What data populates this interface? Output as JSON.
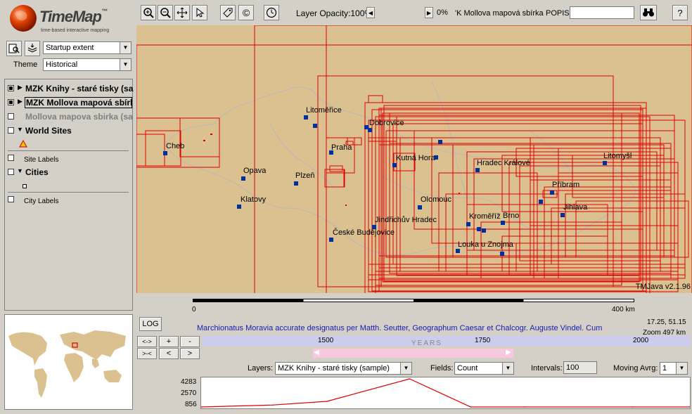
{
  "logo": {
    "title": "TimeMap",
    "tm": "™",
    "subtitle": "time-based interactive mapping"
  },
  "toolbar": {
    "layer_opacity_label": "Layer Opacity:",
    "layer_opacity_value": "100%",
    "opacity_right_value": "0%",
    "active_layer_text": "'K Mollova mapová sbírka",
    "popis_label": "POPIS",
    "popis_value": "",
    "help_label": "?",
    "copyright_label": "©"
  },
  "extent": {
    "selected": "Startup extent"
  },
  "theme": {
    "label": "Theme",
    "selected": "Historical"
  },
  "layers": [
    {
      "label": "MZK Knihy - staré tisky (sa",
      "checked": true
    },
    {
      "label": "MZK Mollova mapová sbírk",
      "checked": true
    },
    {
      "label": "Mollova mapova sbirka (sa",
      "checked": false
    },
    {
      "label": "World Sites",
      "checked": false
    },
    {
      "label": "Site Labels",
      "checked": false
    },
    {
      "label": "Cities",
      "checked": false
    },
    {
      "label": "City Labels",
      "checked": false
    }
  ],
  "map": {
    "version": "TMJava v2.1.96",
    "scale_start": "0",
    "scale_end": "400 km",
    "cities": [
      {
        "name": "Litoměřice"
      },
      {
        "name": "Dobrovice"
      },
      {
        "name": "Hradec Králové"
      },
      {
        "name": "Cheb"
      },
      {
        "name": "Praha"
      },
      {
        "name": "Kutná Hora"
      },
      {
        "name": "Litomyšl"
      },
      {
        "name": "Opava"
      },
      {
        "name": "Plzeň"
      },
      {
        "name": "Příbram"
      },
      {
        "name": "Olomouc"
      },
      {
        "name": "Klatovy"
      },
      {
        "name": "Jihlava"
      },
      {
        "name": "Kroměříž"
      },
      {
        "name": "Kralice"
      },
      {
        "name": "Brno"
      },
      {
        "name": "Jindřichův Hradec"
      },
      {
        "name": "České Budějovice"
      },
      {
        "name": "Louka u Znojma"
      }
    ]
  },
  "info": {
    "log_label": "LOG",
    "description": "Marchionatus Moravia accurate designatus per Matth. Seutter, Geographum Caesar et Chalcogr. Auguste Vindel. Cum",
    "coords": "17.25, 51.15",
    "zoom": "Zoom  497 km"
  },
  "timeline": {
    "years_label": "YEARS",
    "ticks": [
      "1500",
      "1750",
      "2000"
    ],
    "nav_buttons": [
      "<->",
      "+",
      "-",
      ">-<",
      "<",
      ">"
    ]
  },
  "controls": {
    "layers_label": "Layers:",
    "layers_selected": "MZK Knihy - staré tisky (sample)",
    "fields_label": "Fields:",
    "fields_selected": "Count",
    "intervals_label": "Intervals:",
    "intervals_value": "100",
    "moving_avg_label": "Moving Avrg:",
    "moving_avg_value": "1"
  },
  "chart_data": {
    "type": "line",
    "x": [
      1400,
      1500,
      1575,
      1690,
      1775,
      1850,
      2000,
      2080
    ],
    "values": [
      0,
      300,
      856,
      4283,
      0,
      0,
      0,
      0
    ],
    "yticks": [
      "4283",
      "2570",
      "856"
    ],
    "ylim": [
      0,
      4283
    ],
    "xlim": [
      1400,
      2080
    ],
    "grid": false,
    "color": "#e00000"
  },
  "colors": {
    "map_bg": "#dcc190",
    "map_lines": "#e00000",
    "city_marker": "#0030a0"
  }
}
